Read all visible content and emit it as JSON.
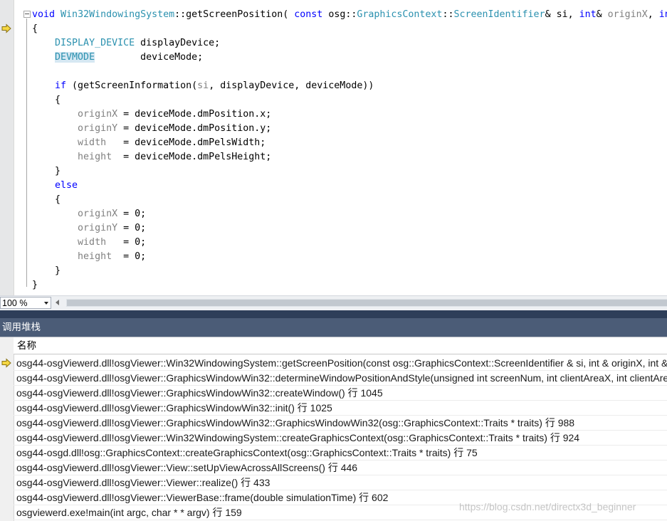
{
  "editor": {
    "lines": [
      [
        {
          "t": "void",
          "c": "kw"
        },
        {
          "t": " "
        },
        {
          "t": "Win32WindowingSystem",
          "c": "ty"
        },
        {
          "t": "::getScreenPosition( "
        },
        {
          "t": "const",
          "c": "kw"
        },
        {
          "t": " osg::"
        },
        {
          "t": "GraphicsContext",
          "c": "ty"
        },
        {
          "t": "::"
        },
        {
          "t": "ScreenIdentifier",
          "c": "ty"
        },
        {
          "t": "& si, "
        },
        {
          "t": "int",
          "c": "kw"
        },
        {
          "t": "& "
        },
        {
          "t": "originX",
          "c": "gr"
        },
        {
          "t": ", "
        },
        {
          "t": "int",
          "c": "kw"
        },
        {
          "t": "& "
        },
        {
          "t": "originY",
          "c": "gr"
        }
      ],
      [
        {
          "t": "{"
        }
      ],
      [
        {
          "t": "    "
        },
        {
          "t": "DISPLAY_DEVICE",
          "c": "ty"
        },
        {
          "t": " displayDevice;"
        }
      ],
      [
        {
          "t": "    "
        },
        {
          "t": "DEVMODE",
          "c": "ty hl"
        },
        {
          "t": "        deviceMode;"
        }
      ],
      [
        {
          "t": ""
        }
      ],
      [
        {
          "t": "    "
        },
        {
          "t": "if",
          "c": "kw"
        },
        {
          "t": " (getScreenInformation("
        },
        {
          "t": "si",
          "c": "gr"
        },
        {
          "t": ", displayDevice, deviceMode))"
        }
      ],
      [
        {
          "t": "    {"
        }
      ],
      [
        {
          "t": "        "
        },
        {
          "t": "originX",
          "c": "gr"
        },
        {
          "t": " = deviceMode.dmPosition.x;"
        }
      ],
      [
        {
          "t": "        "
        },
        {
          "t": "originY",
          "c": "gr"
        },
        {
          "t": " = deviceMode.dmPosition.y;"
        }
      ],
      [
        {
          "t": "        "
        },
        {
          "t": "width",
          "c": "gr"
        },
        {
          "t": "   = deviceMode.dmPelsWidth;"
        }
      ],
      [
        {
          "t": "        "
        },
        {
          "t": "height",
          "c": "gr"
        },
        {
          "t": "  = deviceMode.dmPelsHeight;"
        }
      ],
      [
        {
          "t": "    }"
        }
      ],
      [
        {
          "t": "    "
        },
        {
          "t": "else",
          "c": "kw"
        }
      ],
      [
        {
          "t": "    {"
        }
      ],
      [
        {
          "t": "        "
        },
        {
          "t": "originX",
          "c": "gr"
        },
        {
          "t": " = 0;"
        }
      ],
      [
        {
          "t": "        "
        },
        {
          "t": "originY",
          "c": "gr"
        },
        {
          "t": " = 0;"
        }
      ],
      [
        {
          "t": "        "
        },
        {
          "t": "width",
          "c": "gr"
        },
        {
          "t": "   = 0;"
        }
      ],
      [
        {
          "t": "        "
        },
        {
          "t": "height",
          "c": "gr"
        },
        {
          "t": "  = 0;"
        }
      ],
      [
        {
          "t": "    }"
        }
      ],
      [
        {
          "t": "}"
        }
      ]
    ]
  },
  "zoom": {
    "value": "100 %"
  },
  "call_stack": {
    "title": "调用堆栈",
    "column_header": "名称",
    "frames": [
      "osg44-osgViewerd.dll!osgViewer::Win32WindowingSystem::getScreenPosition(const osg::GraphicsContext::ScreenIdentifier & si, int & originX, int & originY, unsigned int & width, unsigned int & height)",
      "osg44-osgViewerd.dll!osgViewer::GraphicsWindowWin32::determineWindowPositionAndStyle(unsigned int screenNum, int clientAreaX, int clientAreaY, unsigned int clientAreaWidth)",
      "osg44-osgViewerd.dll!osgViewer::GraphicsWindowWin32::createWindow() 行 1045",
      "osg44-osgViewerd.dll!osgViewer::GraphicsWindowWin32::init() 行 1025",
      "osg44-osgViewerd.dll!osgViewer::GraphicsWindowWin32::GraphicsWindowWin32(osg::GraphicsContext::Traits * traits) 行 988",
      "osg44-osgViewerd.dll!osgViewer::Win32WindowingSystem::createGraphicsContext(osg::GraphicsContext::Traits * traits) 行 924",
      "osg44-osgd.dll!osg::GraphicsContext::createGraphicsContext(osg::GraphicsContext::Traits * traits) 行 75",
      "osg44-osgViewerd.dll!osgViewer::View::setUpViewAcrossAllScreens() 行 446",
      "osg44-osgViewerd.dll!osgViewer::Viewer::realize() 行 433",
      "osg44-osgViewerd.dll!osgViewer::ViewerBase::frame(double simulationTime) 行 602",
      "osgviewerd.exe!main(int argc, char * * argv) 行 159"
    ]
  },
  "watermark": "https://blog.csdn.net/directx3d_beginner",
  "colors": {
    "keyword": "#0000ff",
    "type": "#2b91af",
    "param": "#808080",
    "panel_title_bg": "#4b5c77",
    "splitter": "#2e3e59",
    "current_arrow": "#f5d742"
  }
}
